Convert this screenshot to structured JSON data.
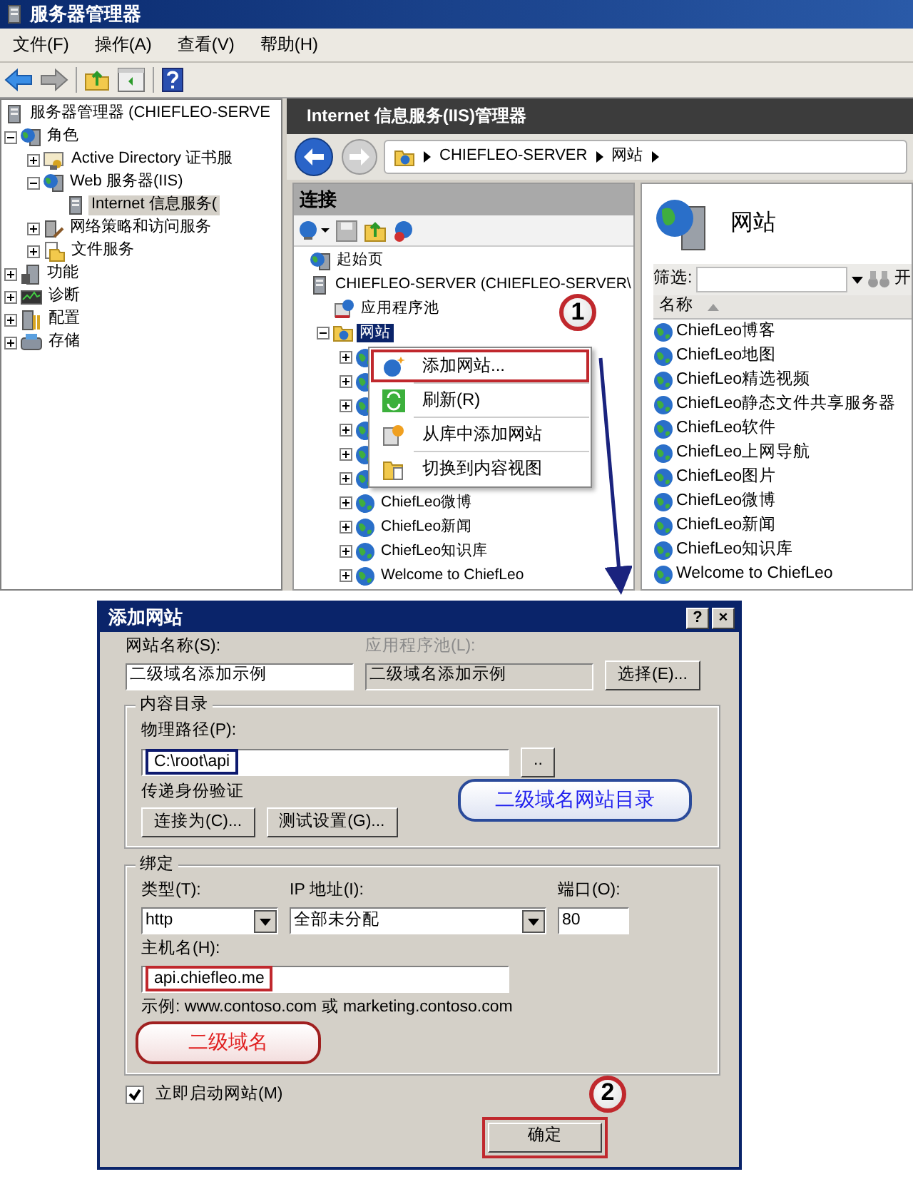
{
  "window": {
    "title": "服务器管理器"
  },
  "menu": [
    "文件(F)",
    "操作(A)",
    "查看(V)",
    "帮助(H)"
  ],
  "tree": {
    "root": "服务器管理器 (CHIEFLEO-SERVE",
    "items": [
      {
        "label": "角色",
        "expanded": true,
        "selected": false,
        "children": [
          {
            "label": "Active Directory 证书服",
            "expanded": false,
            "selected": false
          },
          {
            "label": "Web 服务器(IIS)",
            "expanded": true,
            "selected": false,
            "children": [
              {
                "label": "Internet 信息服务(",
                "selected": true
              }
            ]
          },
          {
            "label": "网络策略和访问服务",
            "expanded": false,
            "selected": false
          },
          {
            "label": "文件服务",
            "expanded": false,
            "selected": false
          }
        ]
      },
      {
        "label": "功能",
        "expanded": false,
        "selected": false
      },
      {
        "label": "诊断",
        "expanded": false,
        "selected": false
      },
      {
        "label": "配置",
        "expanded": false,
        "selected": false
      },
      {
        "label": "存储",
        "expanded": false,
        "selected": false
      }
    ]
  },
  "iis": {
    "title": "Internet 信息服务(IIS)管理器",
    "breadcrumb": [
      "CHIEFLEO-SERVER",
      "网站"
    ],
    "connections": {
      "title": "连接",
      "items": [
        {
          "label": "起始页",
          "selected": false
        },
        {
          "label": "CHIEFLEO-SERVER (CHIEFLEO-SERVER\\",
          "selected": false,
          "children": [
            {
              "label": "应用程序池",
              "selected": false
            },
            {
              "label": "网站",
              "expanded": true,
              "selected": true,
              "children": [
                {
                  "expanded": false
                },
                {
                  "expanded": false
                },
                {
                  "expanded": false
                },
                {
                  "expanded": false
                },
                {
                  "expanded": false
                },
                {
                  "expanded": false
                },
                {
                  "label": "ChiefLeo微博",
                  "expanded": false,
                  "selected": false
                },
                {
                  "label": "ChiefLeo新闻",
                  "expanded": false,
                  "selected": false
                },
                {
                  "label": "ChiefLeo知识库",
                  "expanded": false,
                  "selected": false
                },
                {
                  "label": "Welcome to ChiefLeo",
                  "expanded": false,
                  "selected": false
                }
              ]
            }
          ]
        }
      ]
    },
    "content": {
      "title": "网站",
      "filter_label": "筛选:",
      "filter_button": "开",
      "column": "名称",
      "sites": [
        "ChiefLeo博客",
        "ChiefLeo地图",
        "ChiefLeo精选视频",
        "ChiefLeo静态文件共享服务器",
        "ChiefLeo软件",
        "ChiefLeo上网导航",
        "ChiefLeo图片",
        "ChiefLeo微博",
        "ChiefLeo新闻",
        "ChiefLeo知识库",
        "Welcome to ChiefLeo"
      ]
    }
  },
  "context_menu": {
    "marker": "1",
    "items": [
      {
        "label": "添加网站...",
        "highlighted": true
      },
      {
        "label": "刷新(R)",
        "highlighted": false
      },
      {
        "label": "从库中添加网站",
        "highlighted": false
      },
      {
        "label": "切换到内容视图",
        "highlighted": false
      }
    ]
  },
  "dialog": {
    "title": "添加网站",
    "help": "?",
    "close": "×",
    "site_name": {
      "label": "网站名称(S):",
      "value": "二级域名添加示例"
    },
    "app_pool": {
      "label": "应用程序池(L):",
      "value": "二级域名添加示例",
      "disabled": true
    },
    "select_button": "选择(E)...",
    "content_dir": {
      "legend": "内容目录",
      "path_label": "物理路径(P):",
      "path": {
        "value": "C:\\root\\api",
        "highlighted": true
      },
      "browse": "..",
      "pass_through": "传递身份验证",
      "connect_as": "连接为(C)...",
      "test": "测试设置(G)...",
      "callout": "二级域名网站目录"
    },
    "binding": {
      "legend": "绑定",
      "type_label": "类型(T):",
      "type": "http",
      "ip_label": "IP 地址(I):",
      "ip": "全部未分配",
      "port_label": "端口(O):",
      "port": "80",
      "host_label": "主机名(H):",
      "host": {
        "value": "api.chiefleo.me",
        "highlighted": true
      },
      "example": "示例: www.contoso.com 或 marketing.contoso.com",
      "callout": "二级域名"
    },
    "start_now": {
      "label": "立即启动网站(M)",
      "checked": true
    },
    "ok": {
      "label": "确定",
      "highlighted": true,
      "marker": "2"
    }
  }
}
